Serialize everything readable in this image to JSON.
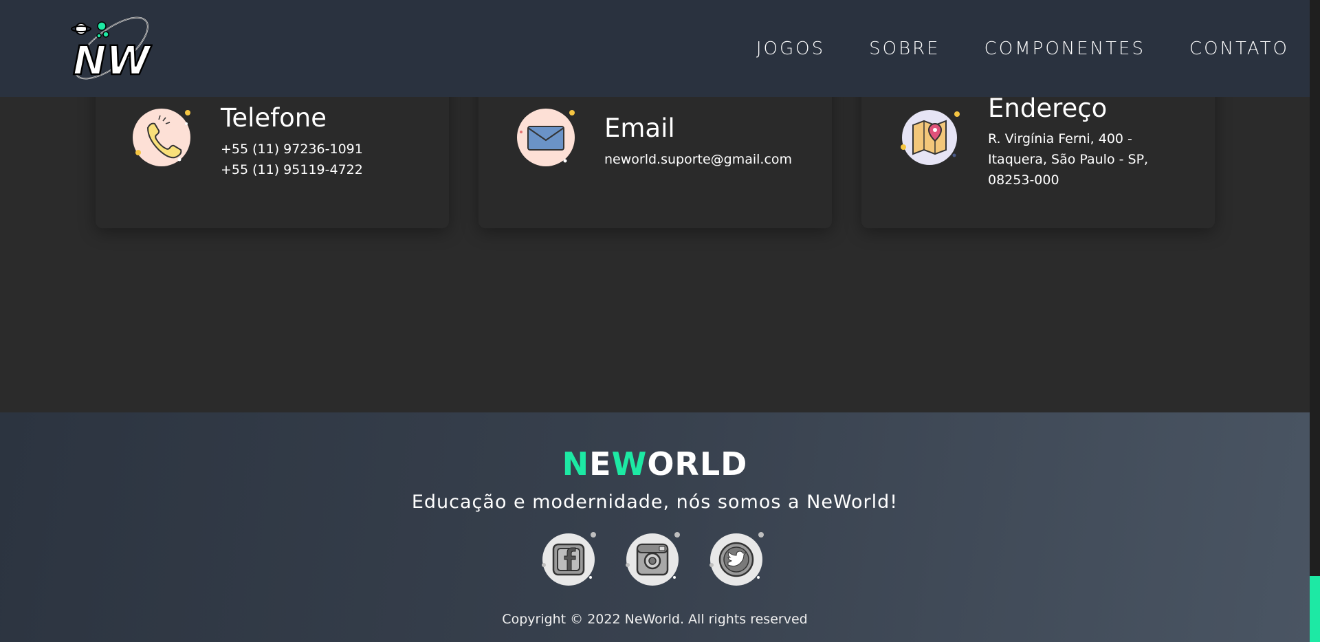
{
  "header": {
    "logo_text": "NW",
    "nav": [
      {
        "label": "JOGOS"
      },
      {
        "label": "SOBRE"
      },
      {
        "label": "COMPONENTES"
      },
      {
        "label": "CONTATO"
      }
    ]
  },
  "contacts": {
    "phone": {
      "title": "Telefone",
      "lines": [
        "+55 (11) 97236-1091",
        "+55 (11) 95119-4722"
      ],
      "icon": "phone-icon"
    },
    "email": {
      "title": "Email",
      "lines": [
        "neworld.suporte@gmail.com"
      ],
      "icon": "envelope-icon"
    },
    "address": {
      "title": "Endereço",
      "lines": [
        "R. Virgínia Ferni, 400 -",
        "Itaquera, São Paulo - SP,",
        "08253-000"
      ],
      "icon": "map-pin-icon"
    }
  },
  "footer": {
    "brand_parts": [
      "N",
      "E",
      "W",
      "ORLD"
    ],
    "slogan": "Educação e modernidade, nós somos a NeWorld!",
    "socials": [
      "facebook-icon",
      "instagram-icon",
      "twitter-icon"
    ],
    "copyright": "Copyright © 2022 NeWorld. All rights reserved"
  },
  "colors": {
    "accent": "#1de9a4",
    "header_bg": "#2a323f",
    "page_bg": "#2b2b2b"
  }
}
